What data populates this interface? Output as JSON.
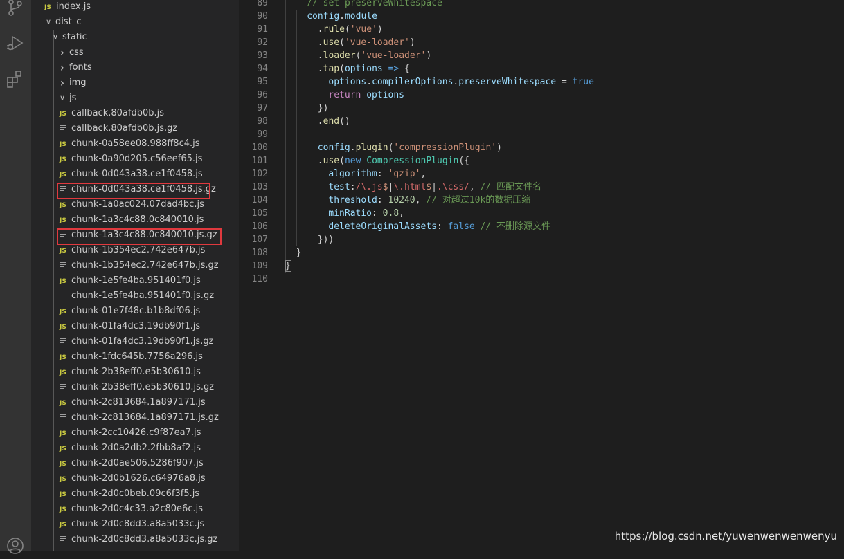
{
  "activity_bar": {
    "icons": [
      "source-control-icon",
      "run-debug-icon",
      "extensions-icon",
      "account-icon"
    ]
  },
  "explorer": {
    "tree": [
      {
        "label": "index.js",
        "type": "js",
        "depth": 1
      },
      {
        "label": "dist_c",
        "type": "folder",
        "expanded": true,
        "depth": 1
      },
      {
        "label": "static",
        "type": "folder",
        "expanded": true,
        "depth": 2
      },
      {
        "label": "css",
        "type": "folder",
        "expanded": false,
        "depth": 3
      },
      {
        "label": "fonts",
        "type": "folder",
        "expanded": false,
        "depth": 3
      },
      {
        "label": "img",
        "type": "folder",
        "expanded": false,
        "depth": 3
      },
      {
        "label": "js",
        "type": "folder",
        "expanded": true,
        "depth": 3
      },
      {
        "label": "callback.80afdb0b.js",
        "type": "js",
        "depth": 4
      },
      {
        "label": "callback.80afdb0b.js.gz",
        "type": "gz",
        "depth": 4
      },
      {
        "label": "chunk-0a58ee08.988ff8c4.js",
        "type": "js",
        "depth": 4
      },
      {
        "label": "chunk-0a90d205.c56eef65.js",
        "type": "js",
        "depth": 4
      },
      {
        "label": "chunk-0d043a38.ce1f0458.js",
        "type": "js",
        "depth": 4
      },
      {
        "label": "chunk-0d043a38.ce1f0458.js.gz",
        "type": "gz",
        "depth": 4,
        "highlighted": true
      },
      {
        "label": "chunk-1a0ac024.07dad4bc.js",
        "type": "js",
        "depth": 4
      },
      {
        "label": "chunk-1a3c4c88.0c840010.js",
        "type": "js",
        "depth": 4
      },
      {
        "label": "chunk-1a3c4c88.0c840010.js.gz",
        "type": "gz",
        "depth": 4,
        "highlighted": true
      },
      {
        "label": "chunk-1b354ec2.742e647b.js",
        "type": "js",
        "depth": 4
      },
      {
        "label": "chunk-1b354ec2.742e647b.js.gz",
        "type": "gz",
        "depth": 4
      },
      {
        "label": "chunk-1e5fe4ba.951401f0.js",
        "type": "js",
        "depth": 4
      },
      {
        "label": "chunk-1e5fe4ba.951401f0.js.gz",
        "type": "gz",
        "depth": 4
      },
      {
        "label": "chunk-01e7f48c.b1b8df06.js",
        "type": "js",
        "depth": 4
      },
      {
        "label": "chunk-01fa4dc3.19db90f1.js",
        "type": "js",
        "depth": 4
      },
      {
        "label": "chunk-01fa4dc3.19db90f1.js.gz",
        "type": "gz",
        "depth": 4
      },
      {
        "label": "chunk-1fdc645b.7756a296.js",
        "type": "js",
        "depth": 4
      },
      {
        "label": "chunk-2b38eff0.e5b30610.js",
        "type": "js",
        "depth": 4
      },
      {
        "label": "chunk-2b38eff0.e5b30610.js.gz",
        "type": "gz",
        "depth": 4
      },
      {
        "label": "chunk-2c813684.1a897171.js",
        "type": "js",
        "depth": 4
      },
      {
        "label": "chunk-2c813684.1a897171.js.gz",
        "type": "gz",
        "depth": 4
      },
      {
        "label": "chunk-2cc10426.c9f87ea7.js",
        "type": "js",
        "depth": 4
      },
      {
        "label": "chunk-2d0a2db2.2fbb8af2.js",
        "type": "js",
        "depth": 4
      },
      {
        "label": "chunk-2d0ae506.5286f907.js",
        "type": "js",
        "depth": 4
      },
      {
        "label": "chunk-2d0b1626.c64976a8.js",
        "type": "js",
        "depth": 4
      },
      {
        "label": "chunk-2d0c0beb.09c6f3f5.js",
        "type": "js",
        "depth": 4
      },
      {
        "label": "chunk-2d0c4c33.a2c80e6c.js",
        "type": "js",
        "depth": 4
      },
      {
        "label": "chunk-2d0c8dd3.a8a5033c.js",
        "type": "js",
        "depth": 4
      },
      {
        "label": "chunk-2d0c8dd3.a8a5033c.js.gz",
        "type": "gz",
        "depth": 4
      }
    ]
  },
  "editor": {
    "lines": [
      {
        "num": "89",
        "indent": 4,
        "tokens": [
          [
            "cmt",
            "// set preserveWhitespace"
          ]
        ]
      },
      {
        "num": "90",
        "indent": 4,
        "tokens": [
          [
            "var",
            "config"
          ],
          [
            "plain",
            "."
          ],
          [
            "var",
            "module"
          ]
        ]
      },
      {
        "num": "91",
        "indent": 6,
        "tokens": [
          [
            "plain",
            "."
          ],
          [
            "fn",
            "rule"
          ],
          [
            "plain",
            "("
          ],
          [
            "str",
            "'vue'"
          ],
          [
            "plain",
            ")"
          ]
        ]
      },
      {
        "num": "92",
        "indent": 6,
        "tokens": [
          [
            "plain",
            "."
          ],
          [
            "fn",
            "use"
          ],
          [
            "plain",
            "("
          ],
          [
            "str",
            "'vue-loader'"
          ],
          [
            "plain",
            ")"
          ]
        ]
      },
      {
        "num": "93",
        "indent": 6,
        "tokens": [
          [
            "plain",
            "."
          ],
          [
            "fn",
            "loader"
          ],
          [
            "plain",
            "("
          ],
          [
            "str",
            "'vue-loader'"
          ],
          [
            "plain",
            ")"
          ]
        ]
      },
      {
        "num": "94",
        "indent": 6,
        "tokens": [
          [
            "plain",
            "."
          ],
          [
            "fn",
            "tap"
          ],
          [
            "plain",
            "("
          ],
          [
            "var",
            "options"
          ],
          [
            "plain",
            " "
          ],
          [
            "kw",
            "=>"
          ],
          [
            "plain",
            " {"
          ]
        ]
      },
      {
        "num": "95",
        "indent": 8,
        "tokens": [
          [
            "var",
            "options"
          ],
          [
            "plain",
            "."
          ],
          [
            "var",
            "compilerOptions"
          ],
          [
            "plain",
            "."
          ],
          [
            "var",
            "preserveWhitespace"
          ],
          [
            "plain",
            " = "
          ],
          [
            "kw",
            "true"
          ]
        ]
      },
      {
        "num": "96",
        "indent": 8,
        "tokens": [
          [
            "ctrl",
            "return"
          ],
          [
            "plain",
            " "
          ],
          [
            "var",
            "options"
          ]
        ]
      },
      {
        "num": "97",
        "indent": 6,
        "tokens": [
          [
            "plain",
            "})"
          ]
        ]
      },
      {
        "num": "98",
        "indent": 6,
        "tokens": [
          [
            "plain",
            "."
          ],
          [
            "fn",
            "end"
          ],
          [
            "plain",
            "()"
          ]
        ]
      },
      {
        "num": "99",
        "indent": 0,
        "tokens": []
      },
      {
        "num": "100",
        "indent": 6,
        "tokens": [
          [
            "var",
            "config"
          ],
          [
            "plain",
            "."
          ],
          [
            "fn",
            "plugin"
          ],
          [
            "plain",
            "("
          ],
          [
            "str",
            "'compressionPlugin'"
          ],
          [
            "plain",
            ")"
          ]
        ]
      },
      {
        "num": "101",
        "indent": 6,
        "tokens": [
          [
            "plain",
            "."
          ],
          [
            "fn",
            "use"
          ],
          [
            "plain",
            "("
          ],
          [
            "kw",
            "new"
          ],
          [
            "plain",
            " "
          ],
          [
            "cls",
            "CompressionPlugin"
          ],
          [
            "plain",
            "({"
          ]
        ]
      },
      {
        "num": "102",
        "indent": 8,
        "tokens": [
          [
            "var",
            "algorithm"
          ],
          [
            "plain",
            ": "
          ],
          [
            "str",
            "'gzip'"
          ],
          [
            "plain",
            ","
          ]
        ]
      },
      {
        "num": "103",
        "indent": 8,
        "tokens": [
          [
            "var",
            "test"
          ],
          [
            "plain",
            ":"
          ],
          [
            "re",
            "/\\.js"
          ],
          [
            "str",
            "$"
          ],
          [
            "plain",
            "|"
          ],
          [
            "re",
            "\\.html"
          ],
          [
            "str",
            "$"
          ],
          [
            "plain",
            "|"
          ],
          [
            "re",
            ".\\css"
          ],
          [
            "re",
            "/"
          ],
          [
            "plain",
            ", "
          ],
          [
            "cmt",
            "// 匹配文件名"
          ]
        ]
      },
      {
        "num": "104",
        "indent": 8,
        "tokens": [
          [
            "var",
            "threshold"
          ],
          [
            "plain",
            ": "
          ],
          [
            "num",
            "10240"
          ],
          [
            "plain",
            ", "
          ],
          [
            "cmt",
            "// 对超过10k的数据压缩"
          ]
        ]
      },
      {
        "num": "105",
        "indent": 8,
        "tokens": [
          [
            "var",
            "minRatio"
          ],
          [
            "plain",
            ": "
          ],
          [
            "num",
            "0.8"
          ],
          [
            "plain",
            ","
          ]
        ]
      },
      {
        "num": "106",
        "indent": 8,
        "tokens": [
          [
            "var",
            "deleteOriginalAssets"
          ],
          [
            "plain",
            ": "
          ],
          [
            "kw",
            "false"
          ],
          [
            "plain",
            " "
          ],
          [
            "cmt",
            "// 不删除源文件"
          ]
        ]
      },
      {
        "num": "107",
        "indent": 6,
        "tokens": [
          [
            "plain",
            "}))"
          ]
        ]
      },
      {
        "num": "108",
        "indent": 2,
        "tokens": [
          [
            "plain",
            "}"
          ]
        ]
      },
      {
        "num": "109",
        "indent": 0,
        "tokens": [
          [
            "plain",
            "}"
          ]
        ]
      },
      {
        "num": "110",
        "indent": 0,
        "tokens": []
      }
    ]
  },
  "watermark": "https://blog.csdn.net/yuwenwenwenwenyu",
  "colors": {
    "highlight_border": "#e0393e",
    "js_icon": "#cbcb41"
  }
}
